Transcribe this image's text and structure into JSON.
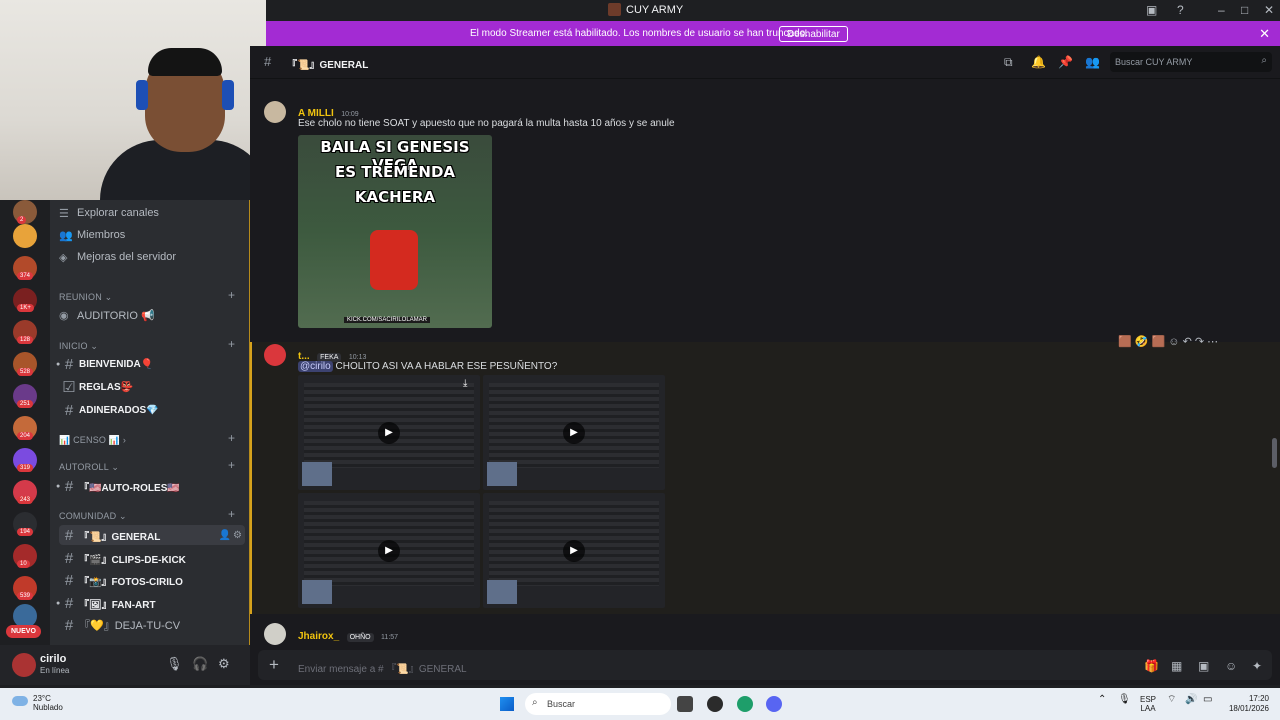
{
  "window": {
    "title": "CUY ARMY"
  },
  "banner": {
    "message": "El modo Streamer está habilitado. Los nombres de usuario se han truncado.",
    "button": "Deshabilitar"
  },
  "servers": {
    "badges": [
      "2",
      "374",
      "1K+",
      "128",
      "528",
      "251",
      "204",
      "319",
      "243",
      "194",
      "10",
      "539"
    ],
    "new_label": "NUEVO"
  },
  "sidebar": {
    "top_items": [
      "Explorar canales",
      "Miembros",
      "Mejoras del servidor"
    ],
    "categories": {
      "reunion": "REUNION",
      "inicio": "INICIO",
      "censo": "CENSO",
      "autoroll": "AUTOROLL",
      "comunidad": "COMUNIDAD"
    },
    "channels": {
      "auditorio": "AUDITORIO 📢",
      "bienvenida": "BIENVENIDA🎈",
      "reglas": "REGLAS👺",
      "adinerados": "ADINERADOS💎",
      "autoroles": "『🇺🇸AUTO-ROLES🇺🇸",
      "general": "『📜』GENERAL",
      "clips": "『🎬』CLIPS-DE-KICK",
      "fotos": "『📸』FOTOS-CIRILO",
      "fanart": "『🖼』FAN-ART",
      "dejatucv": "『💛』DEJA-TU-CV"
    }
  },
  "user": {
    "name": "cirilo",
    "status": "En línea"
  },
  "channel_header": {
    "name": "『📜』GENERAL",
    "search_placeholder": "Buscar CUY ARMY"
  },
  "messages": [
    {
      "author": "A MILLI",
      "author_color": "#f1c40f",
      "time": "10:09",
      "text": "Ese cholo no tiene SOAT y apuesto que no pagará la multa hasta 10 años y se anule",
      "meme_lines": [
        "BAILA SI GENESIS VEGA",
        "ES TREMENDA",
        "KACHERA"
      ],
      "meme_tag": "KICK.COM/SACIRILOLAMAR"
    },
    {
      "author": "t...",
      "author_color": "#f1c40f",
      "role_tag": "FEKA",
      "time": "10:13",
      "mention": "@cirilo",
      "text": "CHOLITO ASI VA A HABLAR ESE PESUÑENTO?"
    },
    {
      "author": "Jhairox_",
      "author_color": "#f1c40f",
      "role_tag": "OHÑO",
      "time": "11:57"
    }
  ],
  "composer": {
    "placeholder": "Enviar mensaje a # 『📜』GENERAL"
  },
  "taskbar": {
    "temperature": "23°C",
    "weather": "Nublado",
    "search": "Buscar",
    "lang_line1": "ESP",
    "lang_line2": "LAA",
    "time": "17:20",
    "date": "18/01/2026"
  }
}
